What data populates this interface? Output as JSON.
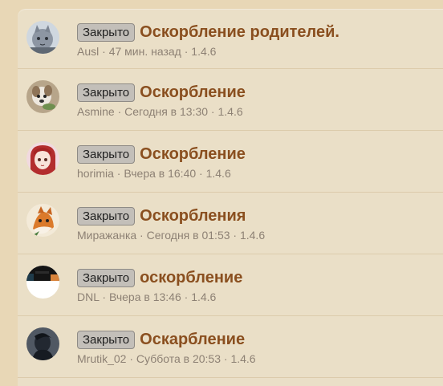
{
  "threads": [
    {
      "status": "Закрыто",
      "title": "Оскорбление родителей.",
      "author": "Ausl",
      "time": "47 мин. назад",
      "version": "1.4.6",
      "avatar_icon": "cat-avatar-icon"
    },
    {
      "status": "Закрыто",
      "title": "Оскорбление",
      "author": "Asmine",
      "time": "Сегодня в 13:30",
      "version": "1.4.6",
      "avatar_icon": "dog-avatar-icon"
    },
    {
      "status": "Закрыто",
      "title": "Оскорбление",
      "author": "horimia",
      "time": "Вчера в 16:40",
      "version": "1.4.6",
      "avatar_icon": "anime-girl-avatar-icon"
    },
    {
      "status": "Закрыто",
      "title": "Оскорбления",
      "author": "Миражанка",
      "time": "Сегодня в 01:53",
      "version": "1.4.6",
      "avatar_icon": "fox-avatar-icon"
    },
    {
      "status": "Закрыто",
      "title": "оскорбление",
      "author": "DNL",
      "time": "Вчера в 13:46",
      "version": "1.4.6",
      "avatar_icon": "dark-scene-avatar-icon"
    },
    {
      "status": "Закрыто",
      "title": "Оскарбление",
      "author": "Mrutik_02",
      "time": "Суббота в 20:53",
      "version": "1.4.6",
      "avatar_icon": "portrait-avatar-icon"
    }
  ],
  "meta_separator": " · ",
  "colors": {
    "page_background": "#e8d7b6",
    "list_background": "#eadfc7",
    "title": "#8a4f1f",
    "meta": "#8d8174",
    "badge_background": "#c3bfb9"
  }
}
